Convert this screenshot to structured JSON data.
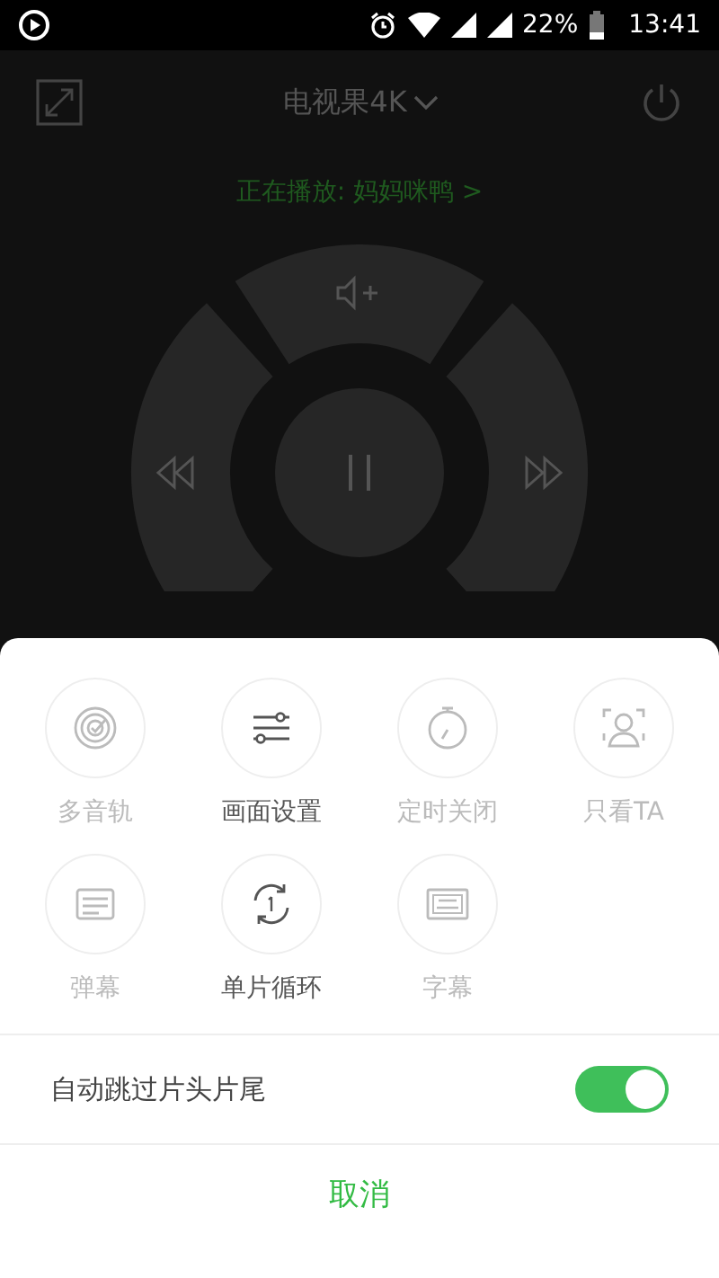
{
  "status_bar": {
    "battery": "22%",
    "time": "13:41"
  },
  "header": {
    "title": "电视果4K",
    "now_playing": "正在播放: 妈妈咪鸭 >"
  },
  "sheet": {
    "items": [
      {
        "label": "多音轨",
        "disabled": true
      },
      {
        "label": "画面设置",
        "disabled": false
      },
      {
        "label": "定时关闭",
        "disabled": true
      },
      {
        "label": "只看TA",
        "disabled": true
      },
      {
        "label": "弹幕",
        "disabled": true
      },
      {
        "label": "单片循环",
        "disabled": false
      },
      {
        "label": "字幕",
        "disabled": true
      }
    ],
    "toggle": {
      "label": "自动跳过片头片尾",
      "on": true
    },
    "cancel": "取消"
  }
}
